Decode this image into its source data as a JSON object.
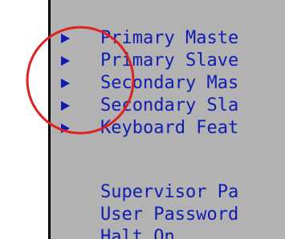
{
  "colors": {
    "panel_background": "#b2b2b2",
    "menu_text": "#101cb0",
    "annotation_circle": "#e02020"
  },
  "submenu_items": [
    {
      "label": "Primary Maste",
      "icon": "submenu-arrow-icon"
    },
    {
      "label": "Primary Slave",
      "icon": "submenu-arrow-icon"
    },
    {
      "label": "Secondary Mas",
      "icon": "submenu-arrow-icon"
    },
    {
      "label": "Secondary Sla",
      "icon": "submenu-arrow-icon"
    },
    {
      "label": "Keyboard Feat",
      "icon": "submenu-arrow-icon"
    }
  ],
  "settings_items": [
    {
      "label": "Supervisor Pa"
    },
    {
      "label": "User Password"
    },
    {
      "label": "Halt On"
    }
  ]
}
